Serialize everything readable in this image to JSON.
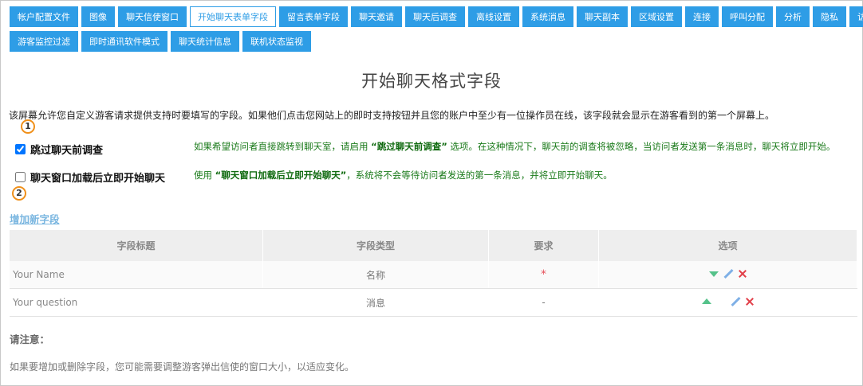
{
  "tabs_row1": [
    {
      "label": "帐户配置文件"
    },
    {
      "label": "图像"
    },
    {
      "label": "聊天信使窗口"
    },
    {
      "label": "开始聊天表单字段",
      "active": true
    },
    {
      "label": "留言表单字段"
    },
    {
      "label": "聊天邀请"
    },
    {
      "label": "聊天后调查"
    },
    {
      "label": "离线设置"
    },
    {
      "label": "系统消息"
    },
    {
      "label": "聊天副本"
    },
    {
      "label": "区域设置"
    },
    {
      "label": "连接"
    },
    {
      "label": "呼叫分配"
    },
    {
      "label": "分析"
    },
    {
      "label": "隐私"
    },
    {
      "label": "访问限制"
    }
  ],
  "tabs_row2": [
    {
      "label": "游客监控过滤"
    },
    {
      "label": "即时通讯软件模式"
    },
    {
      "label": "聊天统计信息"
    },
    {
      "label": "联机状态监视"
    }
  ],
  "page": {
    "title": "开始聊天格式字段",
    "description": "该屏幕允许您自定义游客请求提供支持时要填写的字段。如果他们点击您网站上的即时支持按钮并且您的账户中至少有一位操作员在线，该字段就会显示在游客看到的第一个屏幕上。"
  },
  "badges": [
    "1",
    "2"
  ],
  "options": [
    {
      "label": "跳过聊天前调查",
      "checked": true,
      "desc_pre": "如果希望访问者直接跳转到聊天室，请启用 ",
      "desc_bold": "“跳过聊天前调查”",
      "desc_post": " 选项。在这种情况下，聊天前的调查将被忽略，当访问者发送第一条消息时，聊天将立即开始。"
    },
    {
      "label": "聊天窗口加载后立即开始聊天",
      "checked": false,
      "desc_pre": "使用 ",
      "desc_bold": "“聊天窗口加载后立即开始聊天”",
      "desc_post": "，系统将不会等待访问者发送的第一条消息，并将立即开始聊天。"
    }
  ],
  "add_field_link": "增加新字段",
  "table": {
    "headers": [
      "字段标题",
      "字段类型",
      "要求",
      "选项"
    ],
    "rows": [
      {
        "name": "Your Name",
        "type": "名称",
        "required": "*"
      },
      {
        "name": "Your question",
        "type": "消息",
        "required": "-"
      }
    ]
  },
  "note": {
    "title": "请注意：",
    "text": "如果要增加或删除字段，您可能需要调整游客弹出信使的窗口大小，以适应变化。"
  },
  "colors": {
    "accent": "#2e9de6",
    "badge_border": "#f0901a",
    "option_desc": "#1a7a1a",
    "required_star": "#e6505a"
  }
}
